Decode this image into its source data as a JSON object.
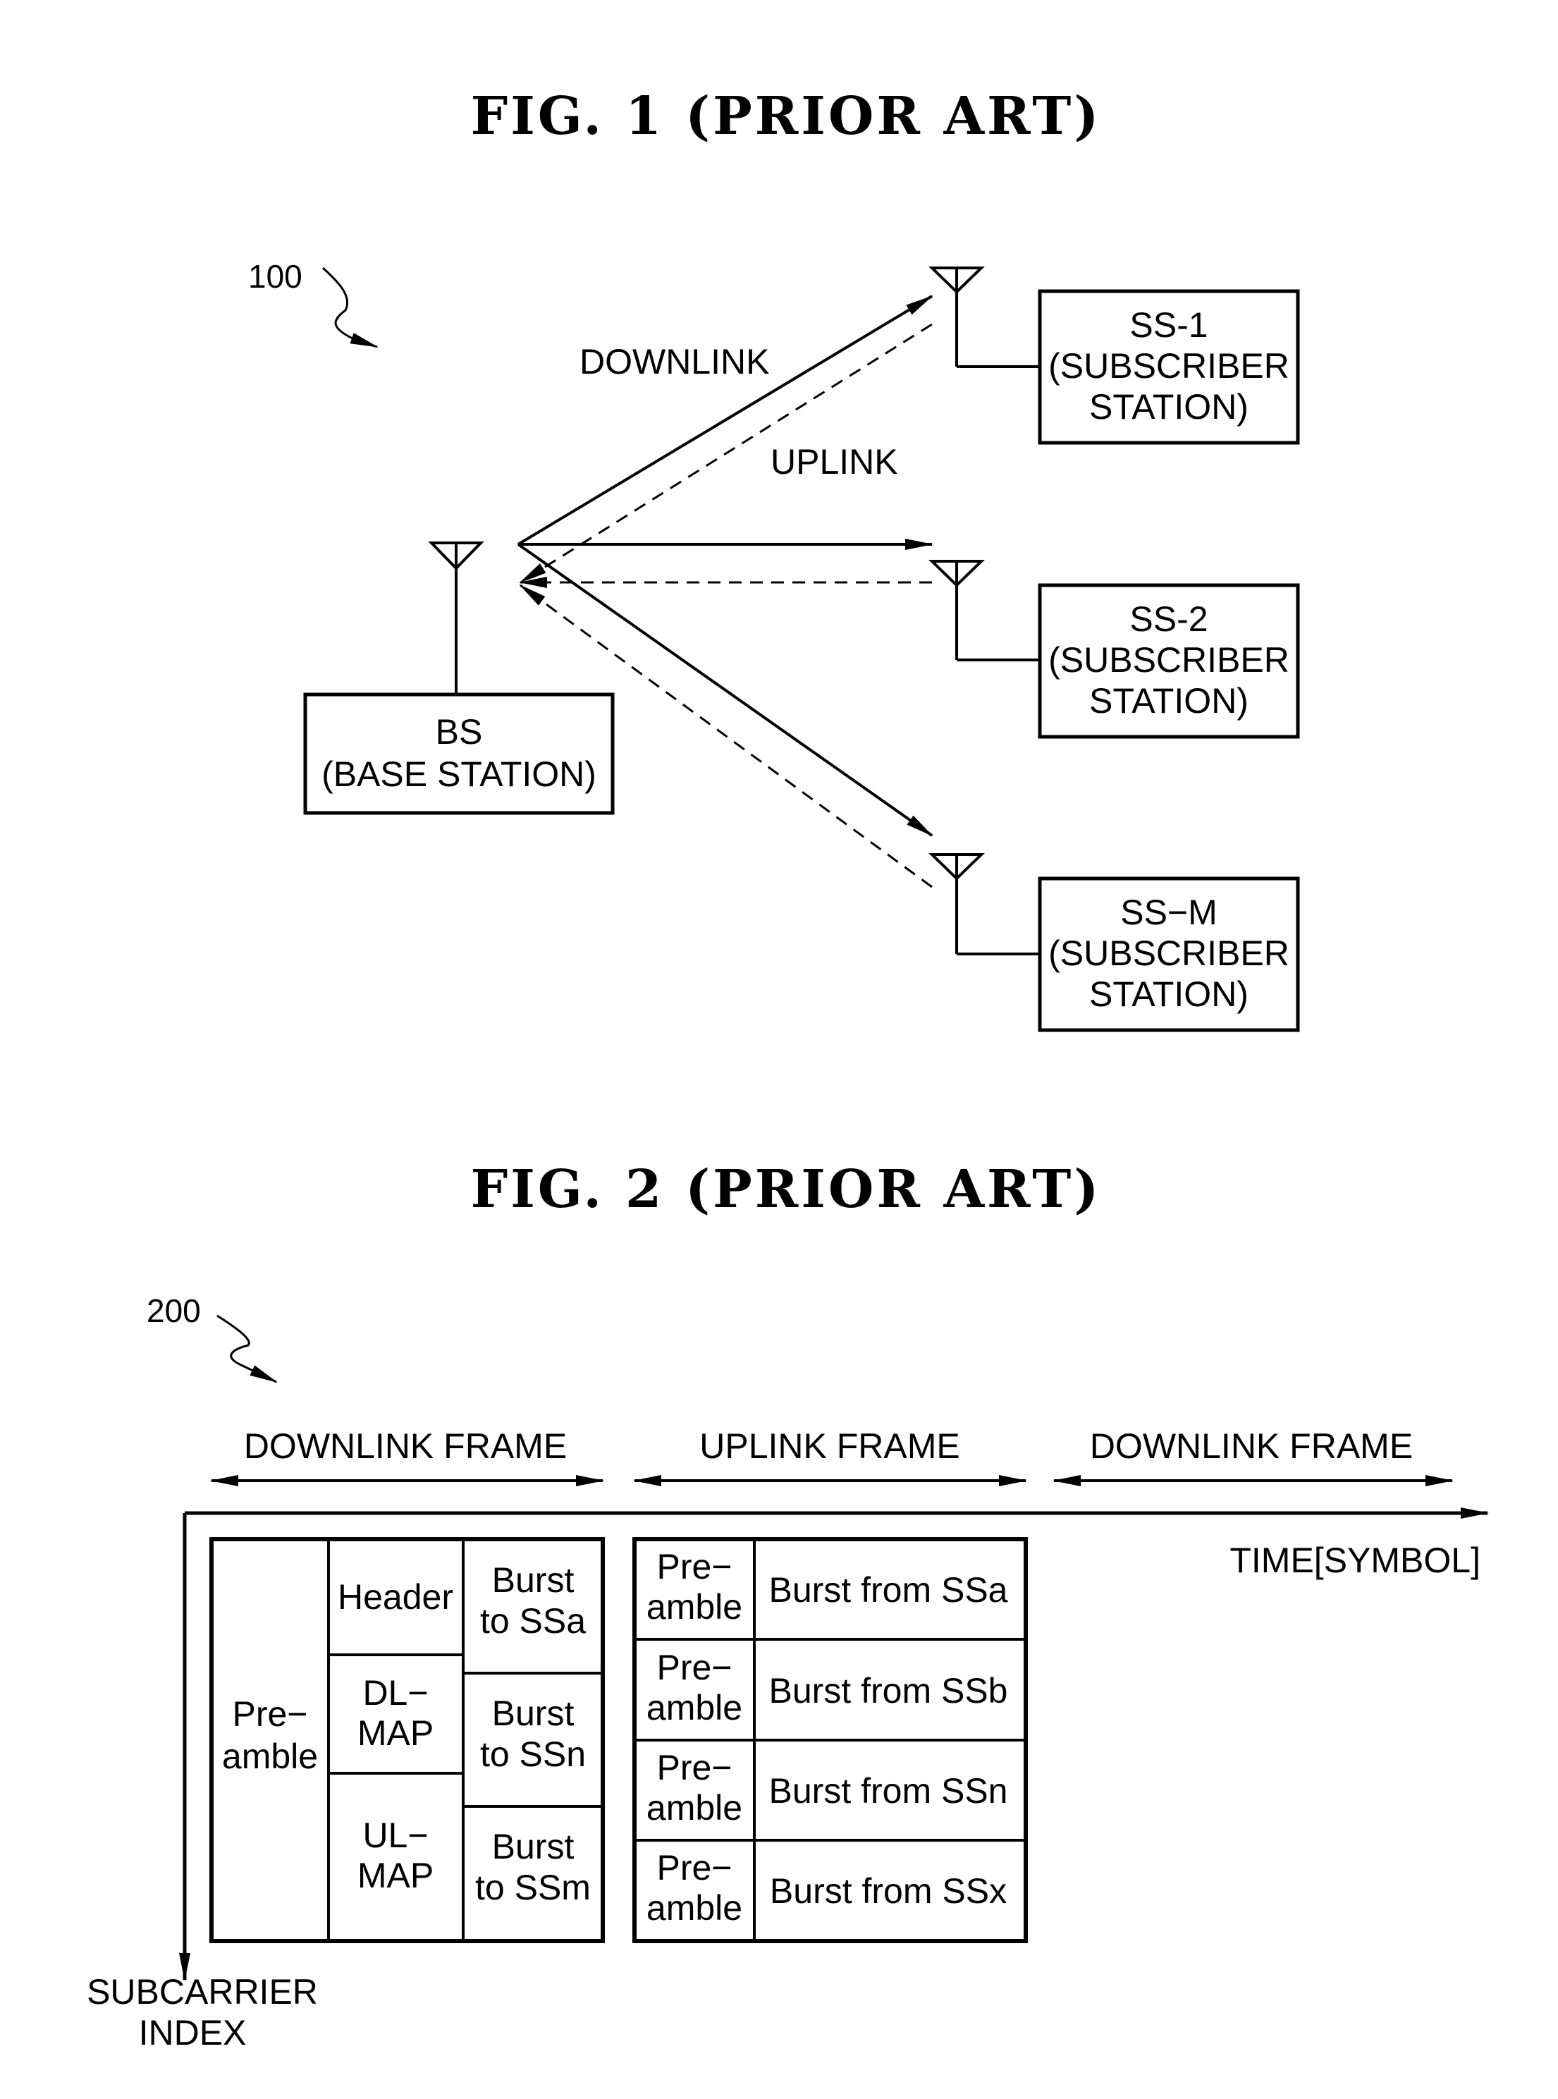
{
  "figure1": {
    "title": "FIG. 1 (PRIOR ART)",
    "ref_numeral": "100",
    "link_labels": {
      "downlink": "DOWNLINK",
      "uplink": "UPLINK"
    },
    "base_station": {
      "line1": "BS",
      "line2": "(BASE STATION)"
    },
    "subscriber_stations": [
      {
        "id": "SS-1",
        "line2": "(SUBSCRIBER",
        "line3": "STATION)"
      },
      {
        "id": "SS-2",
        "line2": "(SUBSCRIBER",
        "line3": "STATION)"
      },
      {
        "id": "SS−M",
        "line2": "(SUBSCRIBER",
        "line3": "STATION)"
      }
    ]
  },
  "figure2": {
    "title": "FIG. 2 (PRIOR ART)",
    "ref_numeral": "200",
    "frame_labels": [
      "DOWNLINK FRAME",
      "UPLINK FRAME",
      "DOWNLINK FRAME"
    ],
    "x_axis_label": "TIME[SYMBOL]",
    "y_axis_label": {
      "line1": "SUBCARRIER",
      "line2": "INDEX"
    },
    "downlink_frame": {
      "preamble": {
        "line1": "Pre−",
        "line2": "amble"
      },
      "header": "Header",
      "dl_map": {
        "line1": "DL−",
        "line2": "MAP"
      },
      "ul_map": {
        "line1": "UL−",
        "line2": "MAP"
      },
      "bursts": [
        {
          "line1": "Burst",
          "line2": "to SSa"
        },
        {
          "line1": "Burst",
          "line2": "to SSn"
        },
        {
          "line1": "Burst",
          "line2": "to SSm"
        }
      ]
    },
    "uplink_frame": {
      "rows": [
        {
          "preamble1": "Pre−",
          "preamble2": "amble",
          "burst": "Burst from SSa"
        },
        {
          "preamble1": "Pre−",
          "preamble2": "amble",
          "burst": "Burst from SSb"
        },
        {
          "preamble1": "Pre−",
          "preamble2": "amble",
          "burst": "Burst from SSn"
        },
        {
          "preamble1": "Pre−",
          "preamble2": "amble",
          "burst": "Burst from SSx"
        }
      ]
    }
  }
}
